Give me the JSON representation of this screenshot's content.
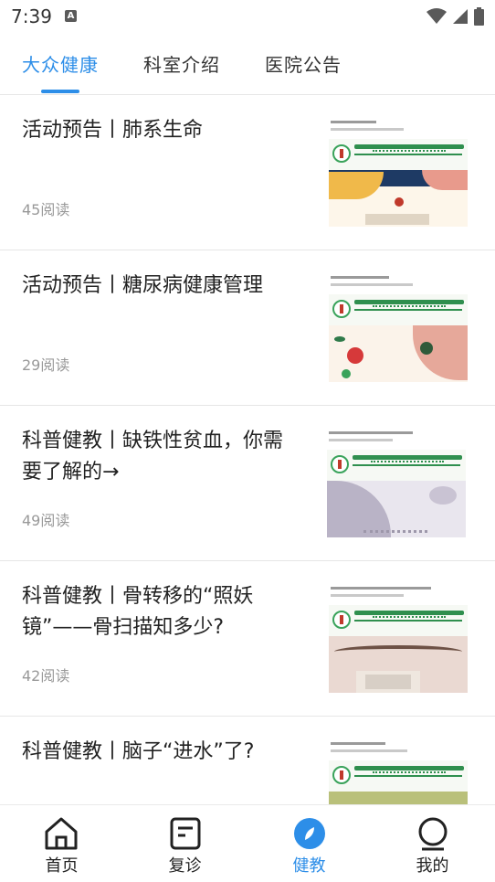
{
  "status_bar": {
    "time": "7:39",
    "notification_glyph": "A"
  },
  "tabs": [
    {
      "label": "大众健康",
      "active": true
    },
    {
      "label": "科室介绍",
      "active": false
    },
    {
      "label": "医院公告",
      "active": false
    }
  ],
  "articles": [
    {
      "title": "活动预告丨肺系生命",
      "reads": "45阅读"
    },
    {
      "title": "活动预告丨糖尿病健康管理",
      "reads": "29阅读"
    },
    {
      "title": "科普健教丨缺铁性贫血，你需要了解的→",
      "reads": "49阅读"
    },
    {
      "title": "科普健教丨骨转移的“照妖镜”——骨扫描知多少?",
      "reads": "42阅读"
    },
    {
      "title": "科普健教丨脑子“进水”了?",
      "reads": ""
    }
  ],
  "bottom_nav": [
    {
      "label": "首页",
      "icon": "home-icon",
      "active": false
    },
    {
      "label": "复诊",
      "icon": "revisit-icon",
      "active": false
    },
    {
      "label": "健教",
      "icon": "education-icon",
      "active": true
    },
    {
      "label": "我的",
      "icon": "profile-icon",
      "active": false
    }
  ],
  "colors": {
    "accent": "#2d8ee8",
    "divider": "#e6e6e6",
    "muted_text": "#999999"
  }
}
